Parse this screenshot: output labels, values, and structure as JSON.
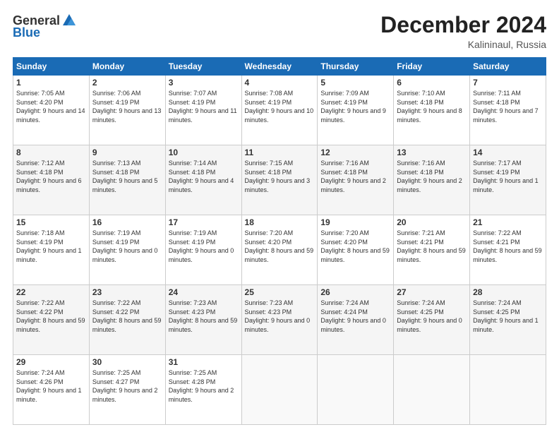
{
  "header": {
    "logo_general": "General",
    "logo_blue": "Blue",
    "month_title": "December 2024",
    "subtitle": "Kalininaul, Russia"
  },
  "days_of_week": [
    "Sunday",
    "Monday",
    "Tuesday",
    "Wednesday",
    "Thursday",
    "Friday",
    "Saturday"
  ],
  "weeks": [
    [
      {
        "num": "1",
        "sunrise": "7:05 AM",
        "sunset": "4:20 PM",
        "daylight": "9 hours and 14 minutes."
      },
      {
        "num": "2",
        "sunrise": "7:06 AM",
        "sunset": "4:19 PM",
        "daylight": "9 hours and 13 minutes."
      },
      {
        "num": "3",
        "sunrise": "7:07 AM",
        "sunset": "4:19 PM",
        "daylight": "9 hours and 11 minutes."
      },
      {
        "num": "4",
        "sunrise": "7:08 AM",
        "sunset": "4:19 PM",
        "daylight": "9 hours and 10 minutes."
      },
      {
        "num": "5",
        "sunrise": "7:09 AM",
        "sunset": "4:19 PM",
        "daylight": "9 hours and 9 minutes."
      },
      {
        "num": "6",
        "sunrise": "7:10 AM",
        "sunset": "4:18 PM",
        "daylight": "9 hours and 8 minutes."
      },
      {
        "num": "7",
        "sunrise": "7:11 AM",
        "sunset": "4:18 PM",
        "daylight": "9 hours and 7 minutes."
      }
    ],
    [
      {
        "num": "8",
        "sunrise": "7:12 AM",
        "sunset": "4:18 PM",
        "daylight": "9 hours and 6 minutes."
      },
      {
        "num": "9",
        "sunrise": "7:13 AM",
        "sunset": "4:18 PM",
        "daylight": "9 hours and 5 minutes."
      },
      {
        "num": "10",
        "sunrise": "7:14 AM",
        "sunset": "4:18 PM",
        "daylight": "9 hours and 4 minutes."
      },
      {
        "num": "11",
        "sunrise": "7:15 AM",
        "sunset": "4:18 PM",
        "daylight": "9 hours and 3 minutes."
      },
      {
        "num": "12",
        "sunrise": "7:16 AM",
        "sunset": "4:18 PM",
        "daylight": "9 hours and 2 minutes."
      },
      {
        "num": "13",
        "sunrise": "7:16 AM",
        "sunset": "4:18 PM",
        "daylight": "9 hours and 2 minutes."
      },
      {
        "num": "14",
        "sunrise": "7:17 AM",
        "sunset": "4:19 PM",
        "daylight": "9 hours and 1 minute."
      }
    ],
    [
      {
        "num": "15",
        "sunrise": "7:18 AM",
        "sunset": "4:19 PM",
        "daylight": "9 hours and 1 minute."
      },
      {
        "num": "16",
        "sunrise": "7:19 AM",
        "sunset": "4:19 PM",
        "daylight": "9 hours and 0 minutes."
      },
      {
        "num": "17",
        "sunrise": "7:19 AM",
        "sunset": "4:19 PM",
        "daylight": "9 hours and 0 minutes."
      },
      {
        "num": "18",
        "sunrise": "7:20 AM",
        "sunset": "4:20 PM",
        "daylight": "8 hours and 59 minutes."
      },
      {
        "num": "19",
        "sunrise": "7:20 AM",
        "sunset": "4:20 PM",
        "daylight": "8 hours and 59 minutes."
      },
      {
        "num": "20",
        "sunrise": "7:21 AM",
        "sunset": "4:21 PM",
        "daylight": "8 hours and 59 minutes."
      },
      {
        "num": "21",
        "sunrise": "7:22 AM",
        "sunset": "4:21 PM",
        "daylight": "8 hours and 59 minutes."
      }
    ],
    [
      {
        "num": "22",
        "sunrise": "7:22 AM",
        "sunset": "4:22 PM",
        "daylight": "8 hours and 59 minutes."
      },
      {
        "num": "23",
        "sunrise": "7:22 AM",
        "sunset": "4:22 PM",
        "daylight": "8 hours and 59 minutes."
      },
      {
        "num": "24",
        "sunrise": "7:23 AM",
        "sunset": "4:23 PM",
        "daylight": "8 hours and 59 minutes."
      },
      {
        "num": "25",
        "sunrise": "7:23 AM",
        "sunset": "4:23 PM",
        "daylight": "9 hours and 0 minutes."
      },
      {
        "num": "26",
        "sunrise": "7:24 AM",
        "sunset": "4:24 PM",
        "daylight": "9 hours and 0 minutes."
      },
      {
        "num": "27",
        "sunrise": "7:24 AM",
        "sunset": "4:25 PM",
        "daylight": "9 hours and 0 minutes."
      },
      {
        "num": "28",
        "sunrise": "7:24 AM",
        "sunset": "4:25 PM",
        "daylight": "9 hours and 1 minute."
      }
    ],
    [
      {
        "num": "29",
        "sunrise": "7:24 AM",
        "sunset": "4:26 PM",
        "daylight": "9 hours and 1 minute."
      },
      {
        "num": "30",
        "sunrise": "7:25 AM",
        "sunset": "4:27 PM",
        "daylight": "9 hours and 2 minutes."
      },
      {
        "num": "31",
        "sunrise": "7:25 AM",
        "sunset": "4:28 PM",
        "daylight": "9 hours and 2 minutes."
      },
      null,
      null,
      null,
      null
    ]
  ],
  "labels": {
    "sunrise": "Sunrise:",
    "sunset": "Sunset:",
    "daylight": "Daylight:"
  }
}
